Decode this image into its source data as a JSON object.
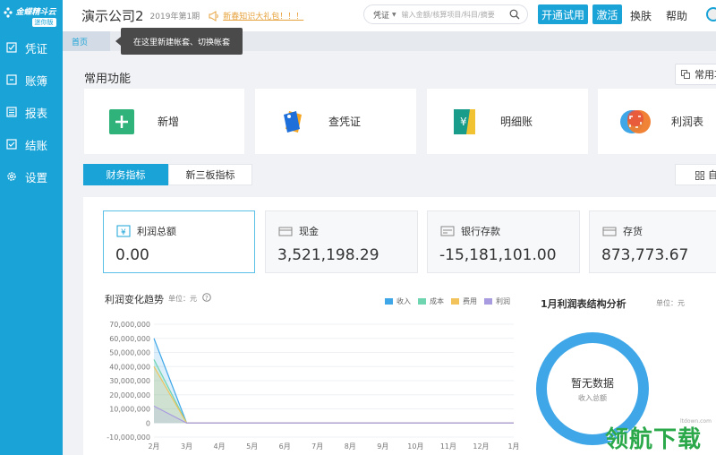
{
  "sidebar": {
    "logo_text": "金蝶精斗云",
    "logo_badge": "迷你版",
    "items": [
      {
        "label": "凭证",
        "icon": "voucher-icon"
      },
      {
        "label": "账簿",
        "icon": "ledger-icon"
      },
      {
        "label": "报表",
        "icon": "report-icon"
      },
      {
        "label": "结账",
        "icon": "checkout-icon"
      },
      {
        "label": "设置",
        "icon": "gear-icon"
      }
    ]
  },
  "header": {
    "company": "演示公司2",
    "period": "2019年第1期",
    "promo": "新春知识大礼包！！！",
    "search_type": "凭证",
    "search_placeholder": "输入金额/核算项目/科目/摘要",
    "trial_button": "开通试用",
    "activate_button": "激活",
    "skin_link": "换肤",
    "help_link": "帮助"
  },
  "tabs": {
    "home": "首页",
    "tooltip": "在这里新建帐套、切换帐套"
  },
  "common": {
    "title": "常用功能",
    "button": "常用功",
    "items": [
      {
        "label": "新增",
        "icon": "add-icon"
      },
      {
        "label": "查凭证",
        "icon": "voucher-tags-icon"
      },
      {
        "label": "明细账",
        "icon": "detail-ledger-icon"
      },
      {
        "label": "利润表",
        "icon": "profit-statement-icon"
      }
    ]
  },
  "metrics": {
    "tab_active": "财务指标",
    "tab_other": "新三板指标",
    "grid_button": "自",
    "cards": [
      {
        "label": "利润总额",
        "value": "0.00"
      },
      {
        "label": "现金",
        "value": "3,521,198.29"
      },
      {
        "label": "银行存款",
        "value": "-15,181,101.00"
      },
      {
        "label": "存货",
        "value": "873,773.67"
      }
    ]
  },
  "trend": {
    "title": "利润变化趋势",
    "unit": "单位：元"
  },
  "structure": {
    "title": "1月利润表结构分析",
    "unit": "单位：元",
    "empty": "暂无数据",
    "sub": "收入总额"
  },
  "watermark": {
    "small": "ltdown.com",
    "main": "领航下载"
  },
  "chart_data": {
    "type": "area",
    "categories": [
      "2月",
      "3月",
      "4月",
      "5月",
      "6月",
      "7月",
      "8月",
      "9月",
      "10月",
      "11月",
      "12月",
      "1月"
    ],
    "ylim": [
      -10000000,
      70000000
    ],
    "yticks": [
      -10000000,
      0,
      10000000,
      20000000,
      30000000,
      40000000,
      50000000,
      60000000,
      70000000
    ],
    "ytick_labels": [
      "-10,000,000",
      "0",
      "10,000,000",
      "20,000,000",
      "30,000,000",
      "40,000,000",
      "50,000,000",
      "60,000,000",
      "70,000,000"
    ],
    "series": [
      {
        "name": "收入",
        "color": "#3fa7e8",
        "values": [
          60000000,
          0,
          0,
          0,
          0,
          0,
          0,
          0,
          0,
          0,
          0,
          0
        ]
      },
      {
        "name": "成本",
        "color": "#6fd4b0",
        "values": [
          45000000,
          0,
          0,
          0,
          0,
          0,
          0,
          0,
          0,
          0,
          0,
          0
        ]
      },
      {
        "name": "费用",
        "color": "#f1c35a",
        "values": [
          40000000,
          0,
          0,
          0,
          0,
          0,
          0,
          0,
          0,
          0,
          0,
          0
        ]
      },
      {
        "name": "利润",
        "color": "#a99be0",
        "values": [
          12000000,
          0,
          0,
          0,
          0,
          0,
          0,
          0,
          0,
          0,
          0,
          0
        ]
      }
    ]
  }
}
